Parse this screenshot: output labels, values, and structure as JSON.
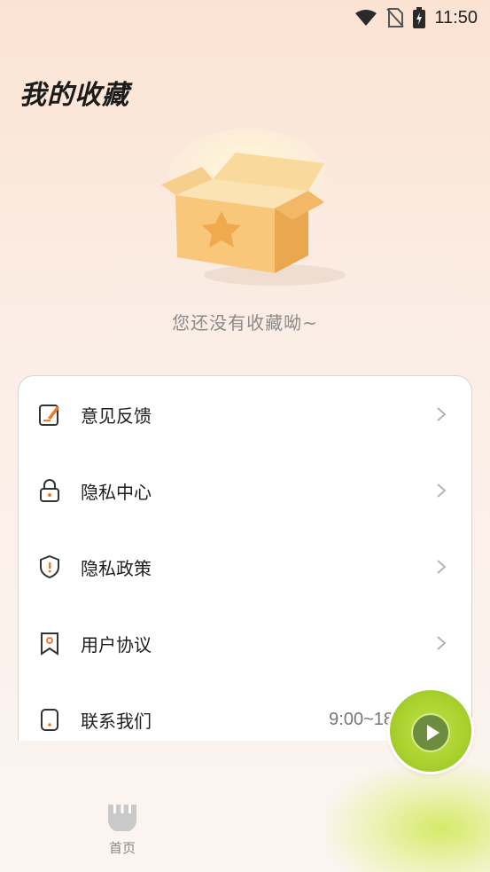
{
  "status_bar": {
    "time": "11:50",
    "icons": [
      "wifi-icon",
      "no-sim-icon",
      "battery-charging-icon"
    ]
  },
  "page": {
    "title": "我的收藏",
    "empty_message": "您还没有收藏呦~"
  },
  "menu": {
    "items": [
      {
        "label": "意见反馈",
        "icon": "feedback-icon",
        "chevron": true
      },
      {
        "label": "隐私中心",
        "icon": "lock-icon",
        "chevron": true
      },
      {
        "label": "隐私政策",
        "icon": "shield-icon",
        "chevron": true
      },
      {
        "label": "用户协议",
        "icon": "bookmark-icon",
        "chevron": true
      },
      {
        "label": "联系我们",
        "icon": "phone-icon",
        "extra": "9:00~18"
      }
    ]
  },
  "bottom_nav": {
    "home_label": "首页"
  },
  "colors": {
    "accent": "#f07a2a",
    "widget": "#a8d12e"
  }
}
